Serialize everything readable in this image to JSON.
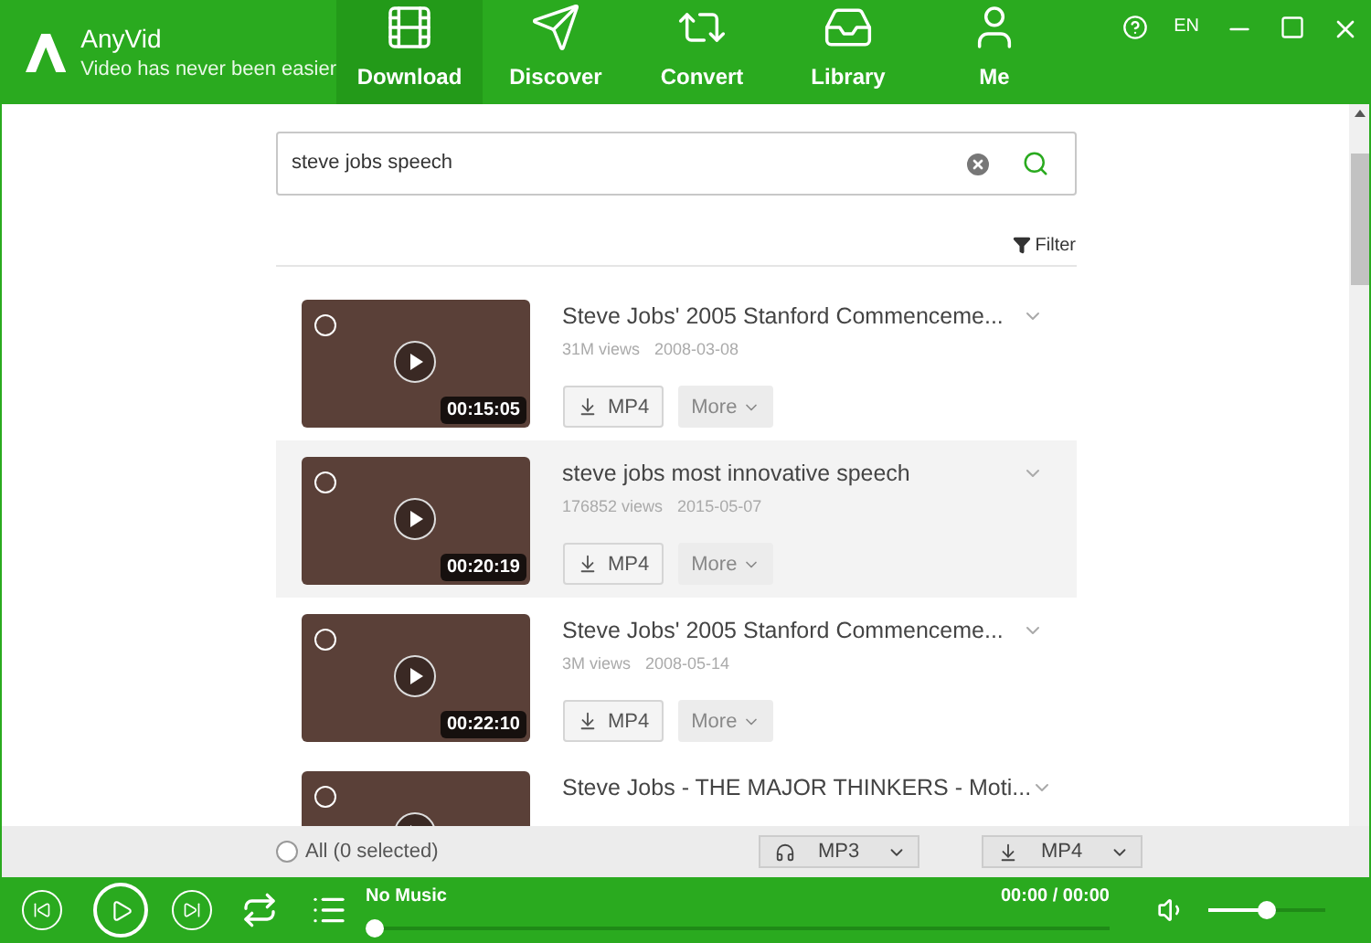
{
  "app": {
    "name": "AnyVid",
    "tagline": "Video has never been easier"
  },
  "nav": [
    {
      "label": "Download",
      "kind": "film",
      "selected": true
    },
    {
      "label": "Discover",
      "kind": "send",
      "selected": false
    },
    {
      "label": "Convert",
      "kind": "convert",
      "selected": false
    },
    {
      "label": "Library",
      "kind": "inbox",
      "selected": false
    },
    {
      "label": "Me",
      "kind": "user",
      "selected": false
    }
  ],
  "language": "EN",
  "search": {
    "value": "steve jobs speech"
  },
  "filter": "Filter",
  "results": [
    {
      "title": "Steve Jobs' 2005 Stanford Commenceme...",
      "views": "31M views",
      "date": "2008-03-08",
      "duration": "00:15:05",
      "format": "MP4",
      "more": "More",
      "highlighted": false
    },
    {
      "title": "steve jobs most innovative speech",
      "views": "176852 views",
      "date": "2015-05-07",
      "duration": "00:20:19",
      "format": "MP4",
      "more": "More",
      "highlighted": true
    },
    {
      "title": "Steve Jobs' 2005 Stanford Commenceme...",
      "views": "3M views",
      "date": "2008-05-14",
      "duration": "00:22:10",
      "format": "MP4",
      "more": "More",
      "highlighted": false
    },
    {
      "title": "Steve Jobs - THE MAJOR THINKERS - Moti...",
      "highlighted": false
    }
  ],
  "bottom_bar": {
    "select_all": {
      "label": "All (0 selected)",
      "checked": false
    },
    "audio_format": "MP3",
    "video_format": "MP4"
  },
  "player": {
    "track": "No Music",
    "time": "00:00 / 00:00",
    "progress": {
      "level": 0
    },
    "volume": {
      "level": 0.5
    }
  }
}
